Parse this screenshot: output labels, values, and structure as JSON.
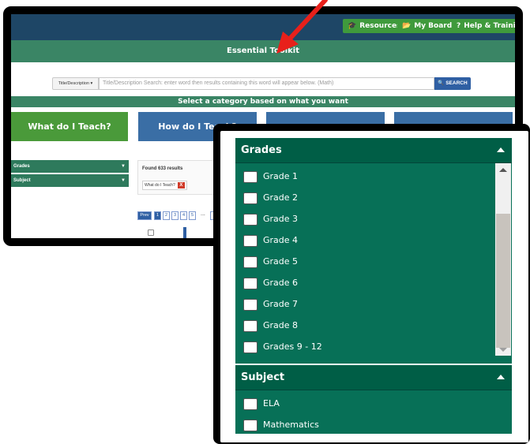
{
  "top_nav": {
    "resources_label": "Resources",
    "myboards_label": "My Boards",
    "help_label": "Help & Training",
    "resources_icon": "graduation-cap-icon",
    "myboards_icon": "folder-icon",
    "help_icon": "question-circle-icon"
  },
  "toolkit_title": "Essential Toolkit",
  "search": {
    "type_label": "Title/Description",
    "placeholder": "Title/Description Search:  enter word then results containing this word will appear below. (Math)",
    "button_label": "SEARCH"
  },
  "category_prompt": "Select a category based on what you want",
  "categories": [
    {
      "label": "What do I Teach?"
    },
    {
      "label": "How do I Teach?"
    },
    {
      "label": ""
    },
    {
      "label": ""
    }
  ],
  "filters": {
    "grades_label": "Grades",
    "subject_label": "Subject"
  },
  "results": {
    "found_text": "Found 633 results",
    "chip_label": "What do I Teach?",
    "chip_remove": "X"
  },
  "pagination": {
    "prev": "Prev",
    "pages": [
      "1",
      "2",
      "3",
      "4",
      "5"
    ],
    "ellipsis": "..."
  },
  "zoom_panel": {
    "grades": {
      "title": "Grades",
      "options": [
        "Grade 1",
        "Grade 2",
        "Grade 3",
        "Grade 4",
        "Grade 5",
        "Grade 6",
        "Grade 7",
        "Grade 8",
        "Grades 9 - 12"
      ]
    },
    "subject": {
      "title": "Subject",
      "options": [
        "ELA",
        "Mathematics"
      ]
    }
  },
  "colors": {
    "nav_blue": "#1e4666",
    "toolkit_green": "#3a8565",
    "panel_green": "#077057",
    "teach_green": "#4a9a3a",
    "category_blue": "#3a6ea5",
    "arrow_red": "#e8201b"
  }
}
